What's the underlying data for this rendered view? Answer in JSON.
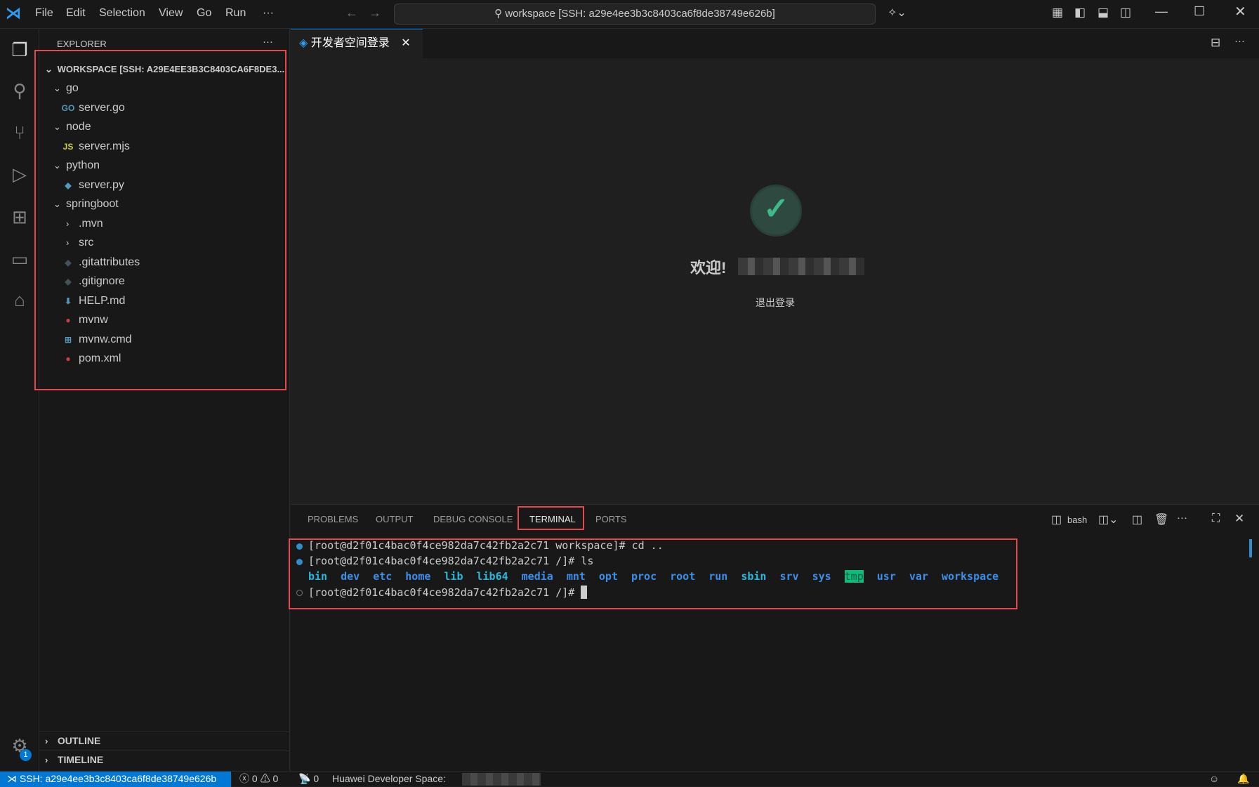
{
  "titlebar": {
    "menus": [
      "File",
      "Edit",
      "Selection",
      "View",
      "Go",
      "Run",
      "···"
    ],
    "command_center": "workspace [SSH: a29e4ee3b3c8403ca6f8de38749e626b]"
  },
  "sidebar": {
    "title": "EXPLORER",
    "more": "···",
    "workspace": "WORKSPACE [SSH: A29E4EE3B3C8403CA6F8DE3...",
    "tree": [
      {
        "label": "go",
        "type": "folder",
        "depth": 1,
        "icon": "",
        "color": "#ccc"
      },
      {
        "label": "server.go",
        "type": "file",
        "depth": 2,
        "icon": "GO",
        "color": "#519aba"
      },
      {
        "label": "node",
        "type": "folder",
        "depth": 1,
        "icon": "",
        "color": "#ccc"
      },
      {
        "label": "server.mjs",
        "type": "file",
        "depth": 2,
        "icon": "JS",
        "color": "#cbcb41"
      },
      {
        "label": "python",
        "type": "folder",
        "depth": 1,
        "icon": "",
        "color": "#ccc"
      },
      {
        "label": "server.py",
        "type": "file",
        "depth": 2,
        "icon": "◆",
        "color": "#519aba"
      },
      {
        "label": "springboot",
        "type": "folder",
        "depth": 1,
        "icon": "",
        "color": "#ccc"
      },
      {
        "label": ".mvn",
        "type": "folder-closed",
        "depth": 2,
        "icon": "",
        "color": "#ccc"
      },
      {
        "label": "src",
        "type": "folder-closed",
        "depth": 2,
        "icon": "",
        "color": "#ccc"
      },
      {
        "label": ".gitattributes",
        "type": "file",
        "depth": 2,
        "icon": "◆",
        "color": "#41535b"
      },
      {
        "label": ".gitignore",
        "type": "file",
        "depth": 2,
        "icon": "◆",
        "color": "#41535b"
      },
      {
        "label": "HELP.md",
        "type": "file",
        "depth": 2,
        "icon": "⬇",
        "color": "#519aba"
      },
      {
        "label": "mvnw",
        "type": "file",
        "depth": 2,
        "icon": "●",
        "color": "#cc3e44"
      },
      {
        "label": "mvnw.cmd",
        "type": "file",
        "depth": 2,
        "icon": "⊞",
        "color": "#519aba"
      },
      {
        "label": "pom.xml",
        "type": "file",
        "depth": 2,
        "icon": "●",
        "color": "#cc3e44"
      }
    ],
    "outline": "OUTLINE",
    "timeline": "TIMELINE"
  },
  "editor": {
    "tab_label": "开发者空间登录",
    "welcome": "欢迎!",
    "logout": "退出登录"
  },
  "panel": {
    "tabs": [
      "PROBLEMS",
      "OUTPUT",
      "DEBUG CONSOLE",
      "TERMINAL",
      "PORTS"
    ],
    "shell": "bash",
    "lines": [
      "[root@d2f01c4bac0f4ce982da7c42fb2a2c71 workspace]# cd ..",
      "[root@d2f01c4bac0f4ce982da7c42fb2a2c71 /]# ls",
      "[root@d2f01c4bac0f4ce982da7c42fb2a2c71 /]# "
    ],
    "ls": [
      "bin",
      "dev",
      "etc",
      "home",
      "lib",
      "lib64",
      "media",
      "mnt",
      "opt",
      "proc",
      "root",
      "run",
      "sbin",
      "srv",
      "sys",
      "tmp",
      "usr",
      "var",
      "workspace"
    ]
  },
  "status": {
    "remote": "SSH: a29e4ee3b3c8403ca6f8de38749e626b",
    "errors": "0",
    "warnings": "0",
    "ports": "0",
    "huawei": "Huawei Developer Space:",
    "settings_badge": "1"
  },
  "colors": {
    "accent": "#0078d4",
    "red_highlight": "#e5484d",
    "check": "#3fb98a"
  }
}
